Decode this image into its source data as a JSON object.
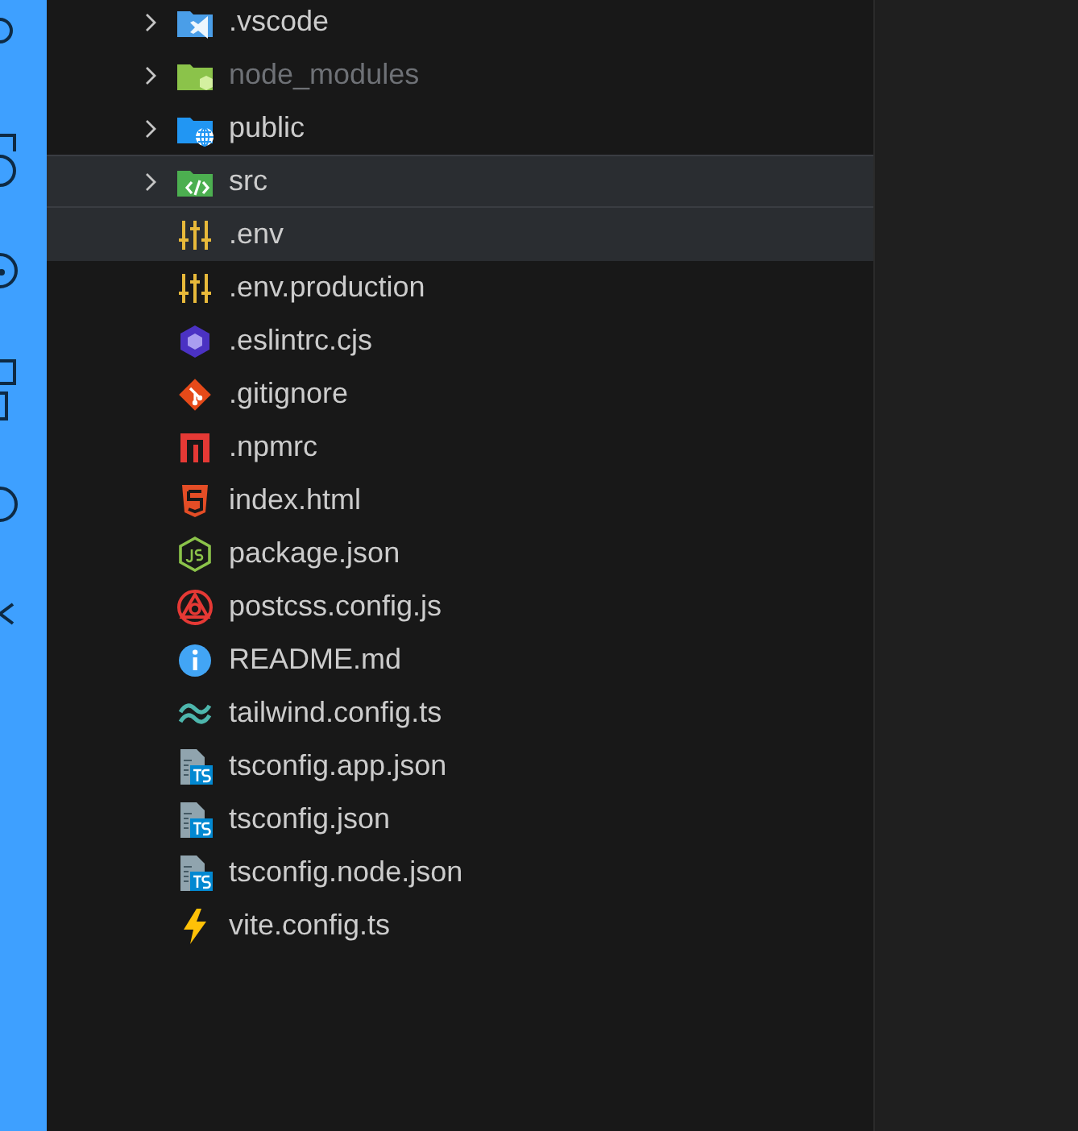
{
  "explorer": {
    "items": [
      {
        "kind": "folder",
        "name": ".vscode",
        "expanded": false,
        "dimmed": false,
        "selected": false,
        "focused": false
      },
      {
        "kind": "folder",
        "name": "node_modules",
        "expanded": false,
        "dimmed": true,
        "selected": false,
        "focused": false
      },
      {
        "kind": "folder",
        "name": "public",
        "expanded": false,
        "dimmed": false,
        "selected": false,
        "focused": false
      },
      {
        "kind": "folder",
        "name": "src",
        "expanded": false,
        "dimmed": false,
        "selected": true,
        "focused": true
      },
      {
        "kind": "file",
        "name": ".env",
        "dimmed": false,
        "selected": true,
        "focused": false
      },
      {
        "kind": "file",
        "name": ".env.production",
        "dimmed": false,
        "selected": false,
        "focused": false
      },
      {
        "kind": "file",
        "name": ".eslintrc.cjs",
        "dimmed": false,
        "selected": false,
        "focused": false
      },
      {
        "kind": "file",
        "name": ".gitignore",
        "dimmed": false,
        "selected": false,
        "focused": false
      },
      {
        "kind": "file",
        "name": ".npmrc",
        "dimmed": false,
        "selected": false,
        "focused": false
      },
      {
        "kind": "file",
        "name": "index.html",
        "dimmed": false,
        "selected": false,
        "focused": false
      },
      {
        "kind": "file",
        "name": "package.json",
        "dimmed": false,
        "selected": false,
        "focused": false
      },
      {
        "kind": "file",
        "name": "postcss.config.js",
        "dimmed": false,
        "selected": false,
        "focused": false
      },
      {
        "kind": "file",
        "name": "README.md",
        "dimmed": false,
        "selected": false,
        "focused": false
      },
      {
        "kind": "file",
        "name": "tailwind.config.ts",
        "dimmed": false,
        "selected": false,
        "focused": false
      },
      {
        "kind": "file",
        "name": "tsconfig.app.json",
        "dimmed": false,
        "selected": false,
        "focused": false
      },
      {
        "kind": "file",
        "name": "tsconfig.json",
        "dimmed": false,
        "selected": false,
        "focused": false
      },
      {
        "kind": "file",
        "name": "tsconfig.node.json",
        "dimmed": false,
        "selected": false,
        "focused": false
      },
      {
        "kind": "file",
        "name": "vite.config.ts",
        "dimmed": false,
        "selected": false,
        "focused": false
      }
    ]
  }
}
